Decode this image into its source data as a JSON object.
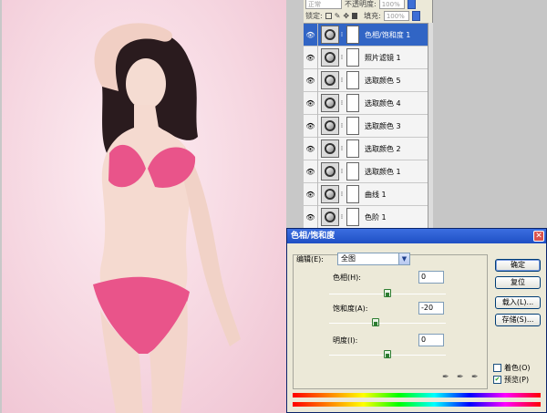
{
  "layers_panel": {
    "mode_text": "正常",
    "opacity_label": "不透明度:",
    "opacity_value": "100%",
    "lock_label": "锁定:",
    "fill_label": "填充:",
    "fill_value": "100%",
    "layers": [
      {
        "name": "色相/饱和度 1",
        "selected": true
      },
      {
        "name": "照片滤镜 1",
        "selected": false
      },
      {
        "name": "选取颜色 5",
        "selected": false
      },
      {
        "name": "选取颜色 4",
        "selected": false
      },
      {
        "name": "选取颜色 3",
        "selected": false
      },
      {
        "name": "选取颜色 2",
        "selected": false
      },
      {
        "name": "选取颜色 1",
        "selected": false
      },
      {
        "name": "曲线 1",
        "selected": false
      },
      {
        "name": "色阶 1",
        "selected": false
      }
    ]
  },
  "dialog": {
    "title": "色相/饱和度",
    "close_glyph": "✕",
    "edit_label": "编辑(E):",
    "edit_value": "全图",
    "hue_label": "色相(H):",
    "hue_value": "0",
    "saturation_label": "饱和度(A):",
    "saturation_value": "-20",
    "lightness_label": "明度(I):",
    "lightness_value": "0",
    "ok_label": "确定",
    "reset_label": "复位",
    "load_label": "载入(L)...",
    "save_label": "存储(S)...",
    "colorize_label": "着色(O)",
    "colorize_checked": false,
    "preview_label": "预览(P)",
    "preview_checked": true,
    "check_glyph": "✔",
    "eyedropper_icons": [
      "eyedropper-icon",
      "eyedropper-plus-icon",
      "eyedropper-minus-icon"
    ]
  },
  "colors": {
    "selected_layer": "#3165c5",
    "title_bar": "#1f4fc4",
    "swimsuit": "#e9548a",
    "background_pink": "#f6d7e1"
  }
}
